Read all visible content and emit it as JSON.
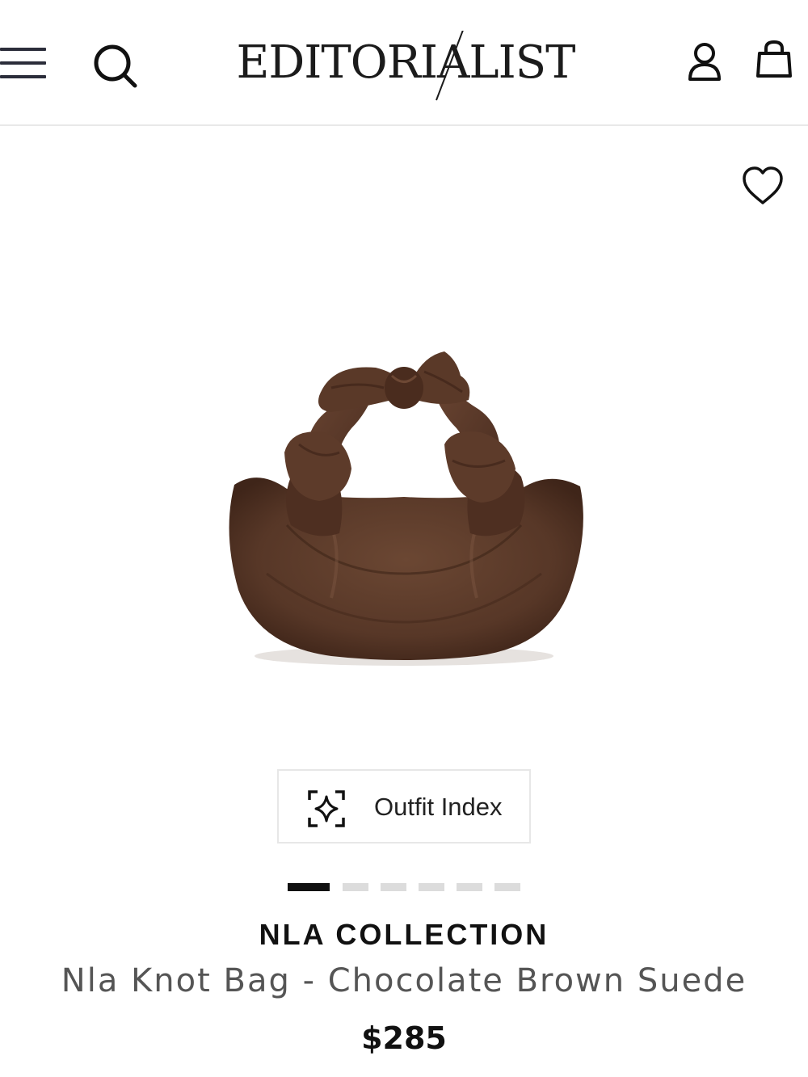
{
  "header": {
    "logo_text": "EDITORIALIST",
    "menu_icon": "hamburger-menu-icon",
    "search_icon": "search-icon",
    "account_icon": "user-icon",
    "bag_icon": "shopping-bag-icon"
  },
  "product": {
    "image_alt": "brown suede knot bag",
    "wishlist_icon": "heart-icon",
    "outfit_index": {
      "icon": "sparkle-scan-icon",
      "label": "Outfit Index"
    },
    "carousel": {
      "total": 6,
      "active_index": 0
    },
    "brand": "NLA COLLECTION",
    "name": "Nla Knot Bag - Chocolate Brown Suede",
    "price": "$285"
  },
  "colors": {
    "text": "#111111",
    "muted_text": "#555555",
    "bag_brown": "#5a3a2a",
    "divider": "#e9e9e9"
  }
}
